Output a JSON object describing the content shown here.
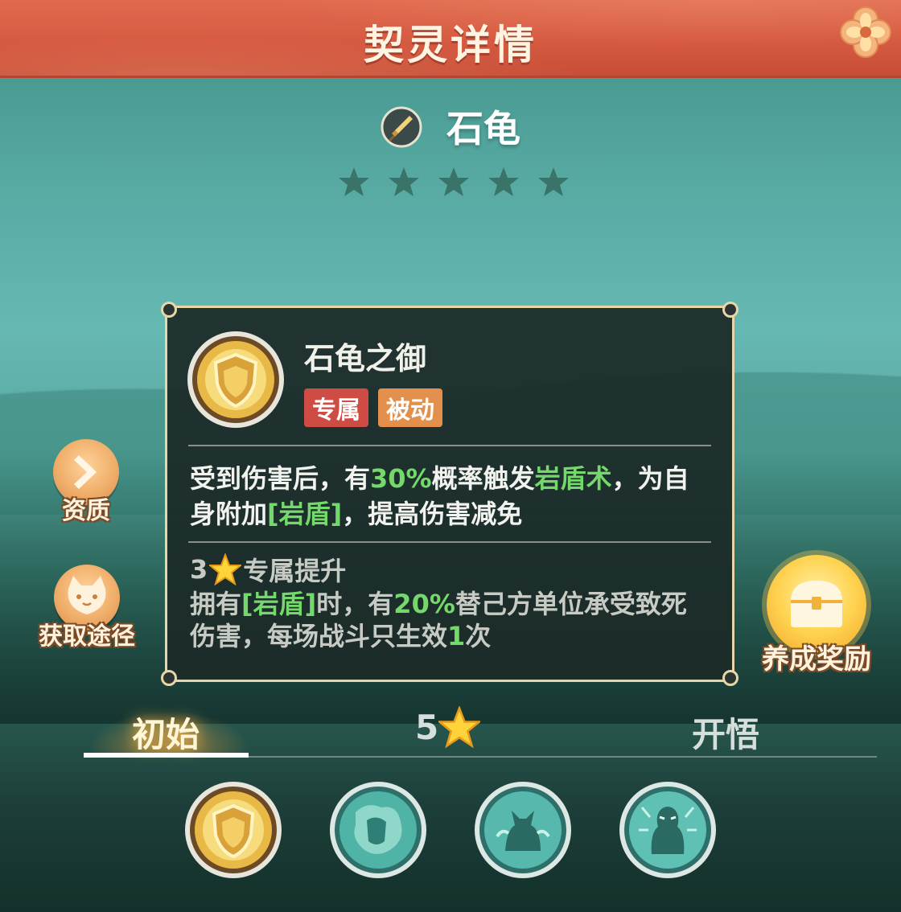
{
  "header": {
    "title": "契灵详情"
  },
  "pet": {
    "name": "石龟",
    "stars_total": 5,
    "stars_filled": 0
  },
  "skill": {
    "name": "石龟之御",
    "tags": [
      "专属",
      "被动"
    ],
    "desc_parts": [
      {
        "t": "受到伤害后，有",
        "c": "normal"
      },
      {
        "t": "30%",
        "c": "green"
      },
      {
        "t": "概率触发",
        "c": "normal"
      },
      {
        "t": "岩盾术",
        "c": "green"
      },
      {
        "t": "，为自身附加",
        "c": "normal"
      },
      {
        "t": "[岩盾]",
        "c": "green"
      },
      {
        "t": "，提高伤害减免",
        "c": "normal"
      }
    ],
    "upgrade_level": "3",
    "upgrade_title": "专属提升",
    "upgrade_parts": [
      {
        "t": "拥有",
        "c": "normal"
      },
      {
        "t": "[岩盾]",
        "c": "green"
      },
      {
        "t": "时，有",
        "c": "normal"
      },
      {
        "t": "20%",
        "c": "green"
      },
      {
        "t": "替己方单位承受致死伤害，每场战斗只生效",
        "c": "normal"
      },
      {
        "t": "1",
        "c": "green"
      },
      {
        "t": "次",
        "c": "normal"
      }
    ]
  },
  "side": {
    "aptitude_label": "资质",
    "obtain_label": "获取途径",
    "reward_label": "养成奖励"
  },
  "tabs": {
    "initial": "初始",
    "five_star": "5",
    "awaken": "开悟"
  },
  "skills_row": [
    "shield-skill-icon",
    "rock-fist-skill-icon",
    "beast-roar-skill-icon",
    "guardian-skill-icon"
  ],
  "colors": {
    "accent_green": "#75d86b",
    "title_red": "#d65a41",
    "panel_border": "#e7d6a7"
  }
}
